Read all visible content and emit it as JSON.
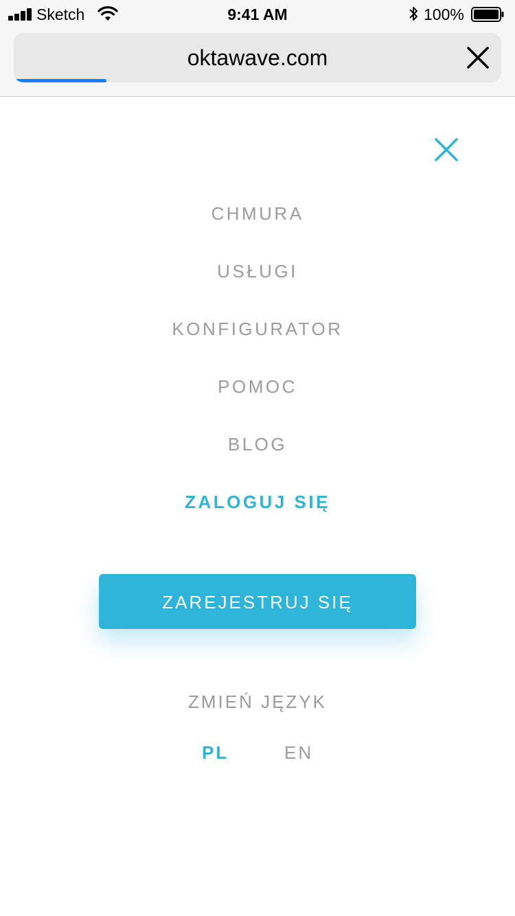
{
  "status_bar": {
    "carrier": "Sketch",
    "time": "9:41 AM",
    "battery": "100%",
    "icons": [
      "signal-icon",
      "wifi-icon",
      "bluetooth-icon",
      "battery-icon"
    ]
  },
  "browser": {
    "url": "oktawave.com",
    "close_icon": "close-icon",
    "load_progress": 0.19
  },
  "menu": {
    "close_icon": "close-icon",
    "items": [
      {
        "label": "CHMURA"
      },
      {
        "label": "USŁUGI"
      },
      {
        "label": "KONFIGURATOR"
      },
      {
        "label": "POMOC"
      },
      {
        "label": "BLOG"
      }
    ],
    "login": "ZALOGUJ SIĘ",
    "register": "ZAREJESTRUJ SIĘ",
    "language": {
      "title": "ZMIEŃ JĘZYK",
      "options": [
        "PL",
        "EN"
      ],
      "selected": "PL"
    }
  },
  "colors": {
    "accent": "#2fb4d9",
    "menu_text": "#9b9b9b",
    "progress": "#157efb"
  }
}
